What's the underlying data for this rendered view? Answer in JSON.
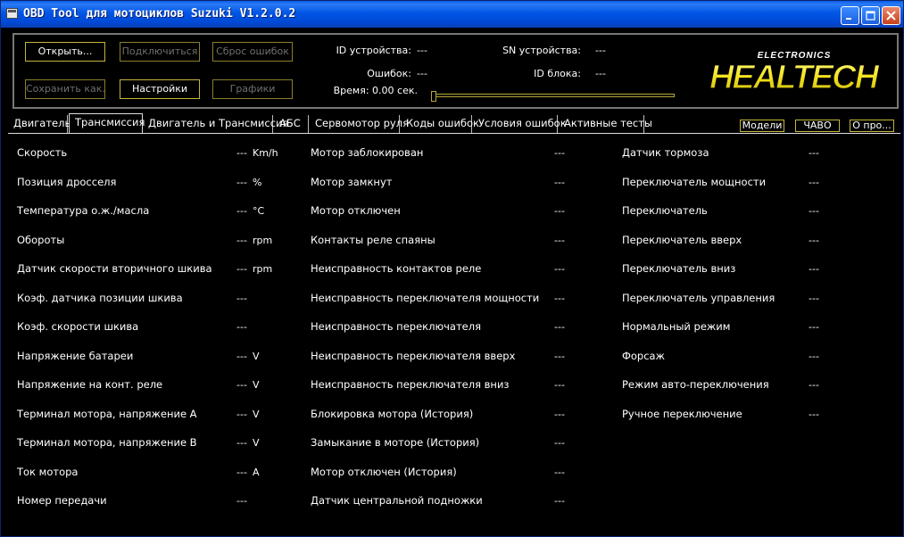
{
  "window": {
    "title": "OBD Tool для мотоциклов Suzuki V1.2.0.2",
    "minimize_icon": "minimize-icon",
    "maximize_icon": "maximize-icon",
    "close_icon": "close-icon"
  },
  "toolbar": {
    "open": "Открыть...",
    "connect": "Подключиться",
    "reset_errors": "Сброс ошибок",
    "save_as": "Сохранить как...",
    "settings": "Настройки",
    "graphs": "Графики"
  },
  "device": {
    "id_label": "ID устройства:",
    "id_value": "---",
    "sn_label": "SN устройства:",
    "sn_value": "---",
    "errors_label": "Ошибок:",
    "errors_value": "---",
    "block_id_label": "ID блока:",
    "block_id_value": "---",
    "time_label": "Время: 0.00 сек.",
    "time_progress": 0.0
  },
  "logo": {
    "main": "HEALTECH",
    "sub": "ELECTRONICS"
  },
  "tabs": [
    {
      "label": "Двигатель",
      "active": false
    },
    {
      "label": "Трансмиссия",
      "active": true
    },
    {
      "label": "Двигатель и Трансмиссия",
      "active": false
    },
    {
      "label": "АБС",
      "active": false
    },
    {
      "label": "Сервомотор руля",
      "active": false
    },
    {
      "label": "Коды ошибок",
      "active": false
    },
    {
      "label": "Условия ошибок",
      "active": false
    },
    {
      "label": "Активные тесты",
      "active": false
    }
  ],
  "side_buttons": {
    "models": "Модели",
    "faq": "ЧАВО",
    "about": "О про..."
  },
  "col1": [
    {
      "label": "Скорость",
      "value": "---",
      "unit": "Km/h"
    },
    {
      "label": "Позиция дросселя",
      "value": "---",
      "unit": "%"
    },
    {
      "label": "Температура о.ж./масла",
      "value": "---",
      "unit": "°C"
    },
    {
      "label": "Обороты",
      "value": "---",
      "unit": "rpm"
    },
    {
      "label": "Датчик скорости вторичного шкива",
      "value": "---",
      "unit": "rpm"
    },
    {
      "label": "Коэф. датчика позиции шкива",
      "value": "---",
      "unit": ""
    },
    {
      "label": "Коэф. скорости шкива",
      "value": "---",
      "unit": ""
    },
    {
      "label": "Напряжение батареи",
      "value": "---",
      "unit": "V"
    },
    {
      "label": "Напряжение на конт. реле",
      "value": "---",
      "unit": "V"
    },
    {
      "label": "Терминал мотора, напряжение A",
      "value": "---",
      "unit": "V"
    },
    {
      "label": "Терминал мотора, напряжение B",
      "value": "---",
      "unit": "V"
    },
    {
      "label": "Ток мотора",
      "value": "---",
      "unit": "A"
    },
    {
      "label": "Номер передачи",
      "value": "---",
      "unit": ""
    }
  ],
  "col2": [
    {
      "label": "Мотор заблокирован",
      "value": "---"
    },
    {
      "label": "Мотор замкнут",
      "value": "---"
    },
    {
      "label": "Мотор отключен",
      "value": "---"
    },
    {
      "label": "Контакты реле спаяны",
      "value": "---"
    },
    {
      "label": "Неисправность контактов реле",
      "value": "---"
    },
    {
      "label": "Неисправность переключателя мощности",
      "value": "---"
    },
    {
      "label": "Неисправность переключателя",
      "value": "---"
    },
    {
      "label": "Неисправность переключателя вверх",
      "value": "---"
    },
    {
      "label": "Неисправность переключателя вниз",
      "value": "---"
    },
    {
      "label": "Блокировка мотора (История)",
      "value": "---"
    },
    {
      "label": "Замыкание в моторе (История)",
      "value": "---"
    },
    {
      "label": "Мотор отключен (История)",
      "value": "---"
    },
    {
      "label": "Датчик центральной подножки",
      "value": "---"
    }
  ],
  "col3": [
    {
      "label": "Датчик тормоза",
      "value": "---"
    },
    {
      "label": "Переключатель мощности",
      "value": "---"
    },
    {
      "label": "Переключатель",
      "value": "---"
    },
    {
      "label": "Переключатель вверх",
      "value": "---"
    },
    {
      "label": "Переключатель вниз",
      "value": "---"
    },
    {
      "label": "Переключатель управления",
      "value": "---"
    },
    {
      "label": "Нормальный режим",
      "value": "---"
    },
    {
      "label": "Форсаж",
      "value": "---"
    },
    {
      "label": "Режим авто-переключения",
      "value": "---"
    },
    {
      "label": "Ручное переключение",
      "value": "---"
    }
  ]
}
